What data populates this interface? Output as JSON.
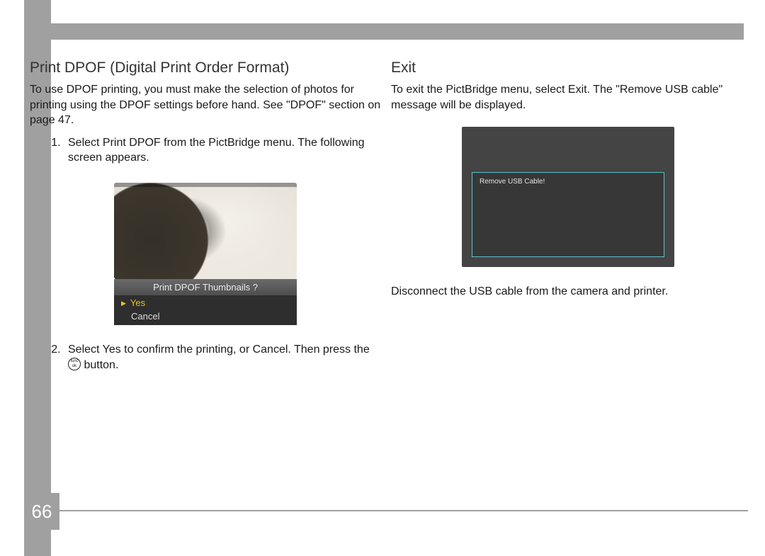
{
  "page_number": "66",
  "left": {
    "heading": "Print DPOF (Digital Print Order Format)",
    "intro": "To use DPOF printing, you must make the selection of photos for printing using the DPOF settings before hand. See \"DPOF\" section on page 47.",
    "step1": "Select Print DPOF from the PictBridge menu.  The following screen appears.",
    "dpof_prompt": "Print DPOF Thumbnails ?",
    "dpof_yes": "Yes",
    "dpof_cancel": "Cancel",
    "step2_pre": "Select Yes to confirm the printing, or Cancel. Then press the ",
    "func_top": "func",
    "func_bot": "ok",
    "step2_post": " button."
  },
  "right": {
    "heading": "Exit",
    "intro": "To exit the PictBridge menu, select Exit. The \"Remove USB cable\" message will be displayed.",
    "usb_msg": "Remove USB Cable!",
    "after": "Disconnect the USB cable from the camera and printer."
  }
}
